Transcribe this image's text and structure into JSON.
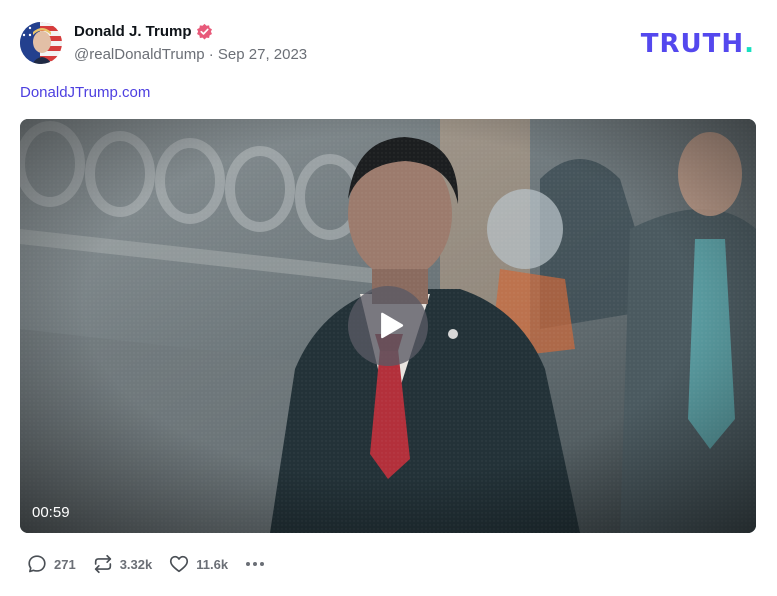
{
  "post": {
    "author": {
      "display_name": "Donald J. Trump",
      "handle": "@realDonaldTrump",
      "separator": " · ",
      "date": "Sep 27, 2023",
      "verified": true,
      "verified_icon": "verified-badge-icon"
    },
    "brand": {
      "logo_text": "TRUTH",
      "logo_dot": ".",
      "logo_color": "#5448ee",
      "logo_dot_color": "#17e0c0"
    },
    "link_text": "DonaldJTrump.com",
    "video": {
      "duration": "00:59",
      "play_icon": "play-icon"
    },
    "actions": {
      "replies": "271",
      "retruths": "3.32k",
      "likes": "11.6k"
    }
  }
}
